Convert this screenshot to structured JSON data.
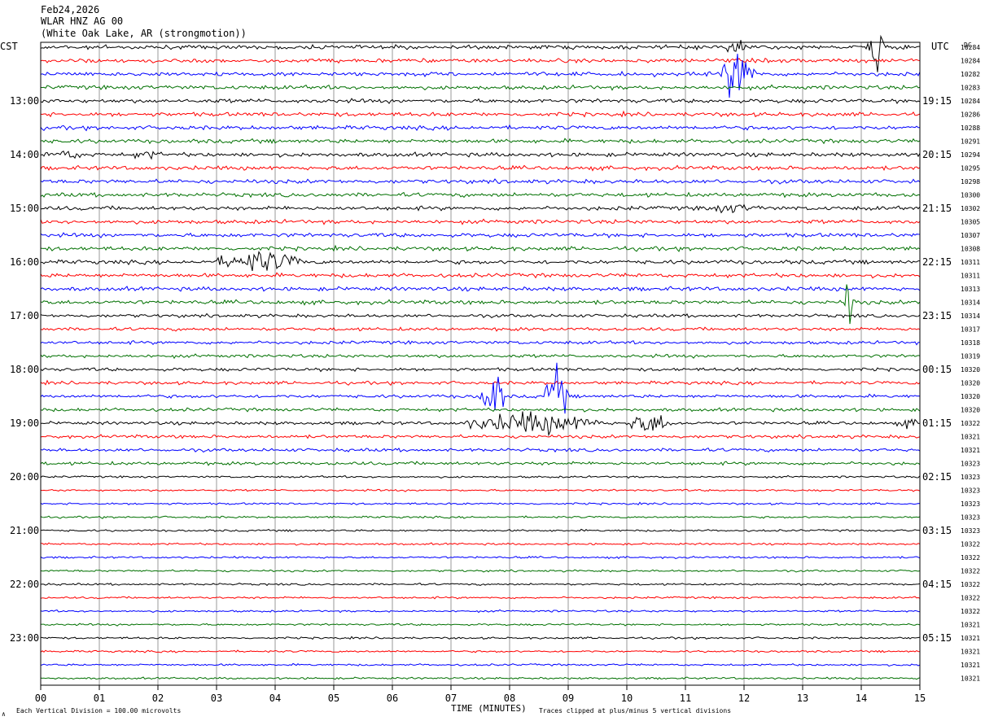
{
  "header": {
    "date": "Feb24,2026",
    "station": "WLAR HNZ AG 00",
    "location": "(White Oak Lake, AR (strongmotion))"
  },
  "left_timezone": "CST",
  "right_timezone": "UTC",
  "dc_header": "DC",
  "footer": {
    "scale_note": "Each Vertical Division =  100.00 microvolts",
    "clip_note": "Traces clipped at plus/minus 5 vertical divisions",
    "corner_mark": "∧"
  },
  "colors": {
    "trace_cycle": [
      "#000000",
      "#ff0000",
      "#0000ff",
      "#007000"
    ],
    "grid": "#999999",
    "frame": "#000000"
  },
  "chart_data": {
    "type": "line",
    "title": "WLAR HNZ AG 00",
    "xlabel": "TIME (MINUTES)",
    "xlim": [
      0,
      15
    ],
    "x_ticks": [
      "00",
      "01",
      "02",
      "03",
      "04",
      "05",
      "06",
      "07",
      "08",
      "09",
      "10",
      "11",
      "12",
      "13",
      "14",
      "15"
    ],
    "trace_count": 48,
    "trace_minutes": 15,
    "left_hour_labels": [
      "13:00",
      "14:00",
      "15:00",
      "16:00",
      "17:00",
      "18:00",
      "19:00",
      "20:00",
      "21:00",
      "22:00",
      "23:00"
    ],
    "right_hour_labels": [
      "19:15",
      "20:15",
      "21:15",
      "22:15",
      "23:15",
      "00:15",
      "01:15",
      "02:15",
      "03:15",
      "04:15",
      "05:15"
    ],
    "dc_offsets": [
      "10284",
      "10284",
      "10282",
      "10283",
      "10284",
      "10286",
      "10288",
      "10291",
      "10294",
      "10295",
      "10298",
      "10300",
      "10302",
      "10305",
      "10307",
      "10308",
      "10311",
      "10311",
      "10313",
      "10314",
      "10314",
      "10317",
      "10318",
      "10319",
      "10320",
      "10320",
      "10320",
      "10320",
      "10322",
      "10321",
      "10321",
      "10323",
      "10323",
      "10323",
      "10323",
      "10323",
      "10323",
      "10322",
      "10322",
      "10322",
      "10322",
      "10322",
      "10322",
      "10321",
      "10321",
      "10321",
      "10321",
      "10321"
    ],
    "clip_divisions": 5,
    "events": [
      {
        "trace": 0,
        "minute_start": 11.7,
        "minute_end": 12.1,
        "amplitude": "large"
      },
      {
        "trace": 0,
        "minute_start": 14.1,
        "minute_end": 14.4,
        "amplitude": "clipped"
      },
      {
        "trace": 2,
        "minute_start": 11.6,
        "minute_end": 12.2,
        "amplitude": "clipped"
      },
      {
        "trace": 8,
        "minute_start": 0.0,
        "minute_end": 0.9,
        "amplitude": "moderate"
      },
      {
        "trace": 8,
        "minute_start": 1.5,
        "minute_end": 2.1,
        "amplitude": "moderate"
      },
      {
        "trace": 12,
        "minute_start": 11.2,
        "minute_end": 12.4,
        "amplitude": "moderate"
      },
      {
        "trace": 16,
        "minute_start": 3.0,
        "minute_end": 4.5,
        "amplitude": "large"
      },
      {
        "trace": 19,
        "minute_start": 13.7,
        "minute_end": 13.9,
        "amplitude": "clipped"
      },
      {
        "trace": 26,
        "minute_start": 7.5,
        "minute_end": 7.9,
        "amplitude": "clipped"
      },
      {
        "trace": 26,
        "minute_start": 8.6,
        "minute_end": 9.0,
        "amplitude": "clipped"
      },
      {
        "trace": 28,
        "minute_start": 7.2,
        "minute_end": 9.6,
        "amplitude": "large"
      },
      {
        "trace": 28,
        "minute_start": 10.0,
        "minute_end": 10.8,
        "amplitude": "large"
      },
      {
        "trace": 28,
        "minute_start": 14.6,
        "minute_end": 15.0,
        "amplitude": "moderate"
      }
    ]
  }
}
